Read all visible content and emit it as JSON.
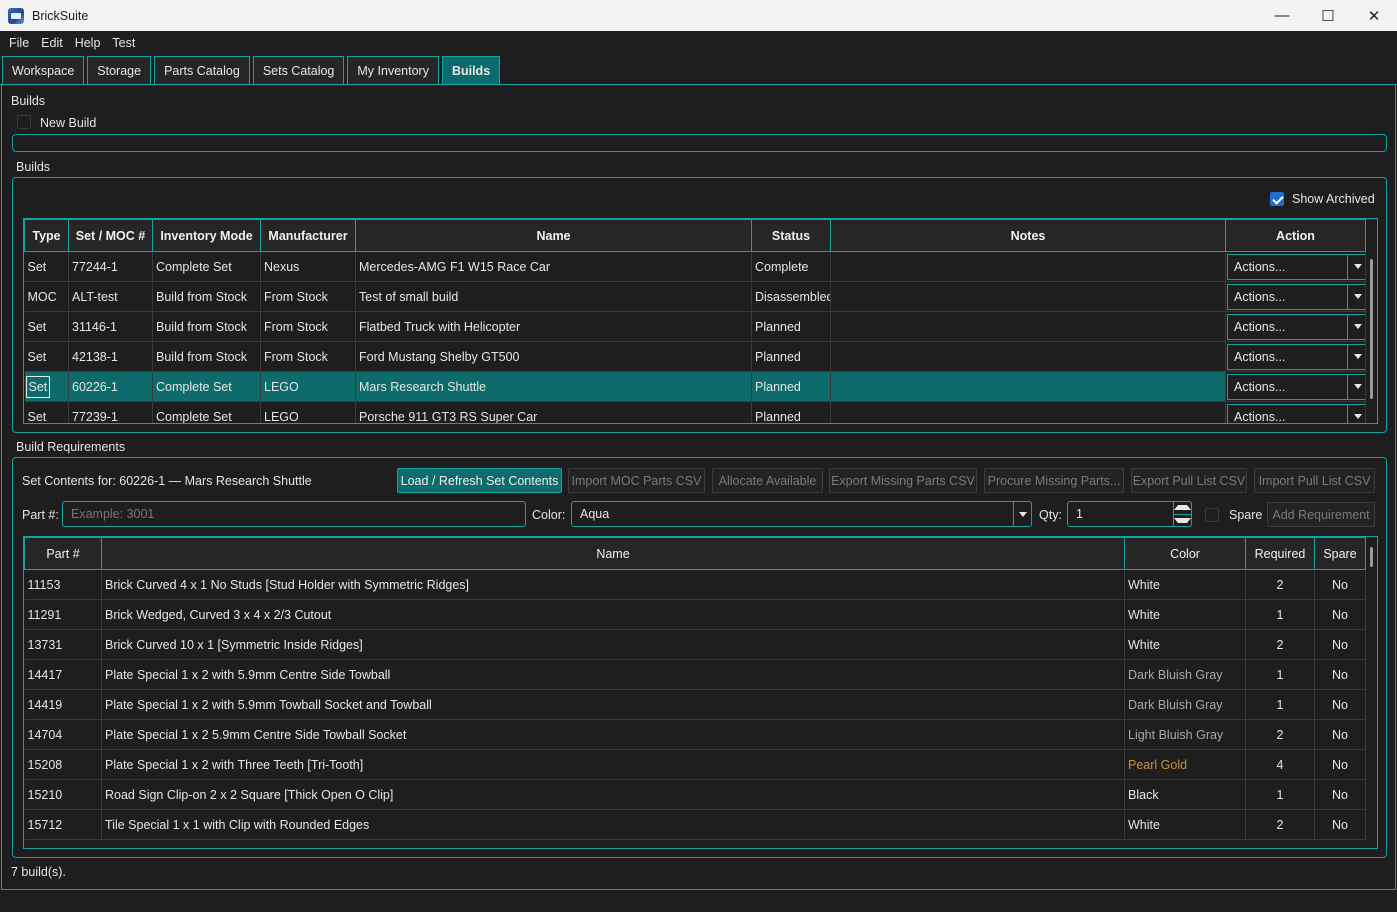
{
  "window": {
    "title": "BrickSuite",
    "minimize": "—",
    "maximize": "☐",
    "close": "✕"
  },
  "menu": [
    "File",
    "Edit",
    "Help",
    "Test"
  ],
  "tabs": [
    {
      "label": "Workspace",
      "active": false
    },
    {
      "label": "Storage",
      "active": false
    },
    {
      "label": "Parts Catalog",
      "active": false
    },
    {
      "label": "Sets Catalog",
      "active": false
    },
    {
      "label": "My Inventory",
      "active": false
    },
    {
      "label": "Builds",
      "active": true
    }
  ],
  "builds_header": {
    "section_label": "Builds",
    "new_build_label": "New Build",
    "group_title": "Builds",
    "show_archived_label": "Show Archived",
    "show_archived_checked": true
  },
  "builds_table": {
    "columns": [
      "Type",
      "Set / MOC #",
      "Inventory Mode",
      "Manufacturer",
      "Name",
      "Status",
      "Notes",
      "Action"
    ],
    "rows": [
      {
        "type": "Set",
        "number": "77244-1",
        "mode": "Complete Set",
        "manufacturer": "Nexus",
        "name": "Mercedes-AMG F1 W15 Race Car",
        "status": "Complete",
        "notes": "",
        "action": "Actions..."
      },
      {
        "type": "MOC",
        "number": "ALT-test",
        "mode": "Build from Stock",
        "manufacturer": "From Stock",
        "name": "Test of small build",
        "status": "Disassembled",
        "notes": "",
        "action": "Actions..."
      },
      {
        "type": "Set",
        "number": "31146-1",
        "mode": "Build from Stock",
        "manufacturer": "From Stock",
        "name": "Flatbed Truck with Helicopter",
        "status": "Planned",
        "notes": "",
        "action": "Actions..."
      },
      {
        "type": "Set",
        "number": "42138-1",
        "mode": "Build from Stock",
        "manufacturer": "From Stock",
        "name": "Ford Mustang Shelby GT500",
        "status": "Planned",
        "notes": "",
        "action": "Actions..."
      },
      {
        "type": "Set",
        "number": "60226-1",
        "mode": "Complete Set",
        "manufacturer": "LEGO",
        "name": "Mars Research Shuttle",
        "status": "Planned",
        "notes": "",
        "action": "Actions...",
        "selected": true
      },
      {
        "type": "Set",
        "number": "77239-1",
        "mode": "Complete Set",
        "manufacturer": "LEGO",
        "name": "Porsche 911 GT3 RS Super Car",
        "status": "Planned",
        "notes": "",
        "action": "Actions..."
      }
    ]
  },
  "requirements": {
    "group_title": "Build Requirements",
    "set_contents_label": "Set Contents for: 60226-1 — Mars Research Shuttle",
    "buttons": {
      "load_refresh": "Load / Refresh Set Contents",
      "import_moc": "Import MOC Parts CSV",
      "allocate": "Allocate Available",
      "export_missing": "Export Missing Parts CSV",
      "procure_missing": "Procure Missing Parts...",
      "export_pull": "Export Pull List CSV",
      "import_pull": "Import Pull List CSV",
      "add_requirement": "Add Requirement"
    },
    "part_label": "Part #:",
    "part_placeholder": "Example: 3001",
    "color_label": "Color:",
    "color_value": "Aqua",
    "qty_label": "Qty:",
    "qty_value": "1",
    "spare_label": "Spare",
    "columns": [
      "Part #",
      "Name",
      "Color",
      "Required",
      "Spare"
    ],
    "rows": [
      {
        "part": "11153",
        "name": "Brick Curved 4 x 1 No Studs [Stud Holder with Symmetric Ridges]",
        "color": "White",
        "color_style": "normal",
        "required": "2",
        "spare": "No"
      },
      {
        "part": "11291",
        "name": "Brick Wedged, Curved 3 x 4 x 2/3 Cutout",
        "color": "White",
        "color_style": "normal",
        "required": "1",
        "spare": "No"
      },
      {
        "part": "13731",
        "name": "Brick Curved 10 x 1 [Symmetric Inside Ridges]",
        "color": "White",
        "color_style": "normal",
        "required": "2",
        "spare": "No"
      },
      {
        "part": "14417",
        "name": "Plate Special 1 x 2 with 5.9mm Centre Side Towball",
        "color": "Dark Bluish Gray",
        "color_style": "dim",
        "required": "1",
        "spare": "No"
      },
      {
        "part": "14419",
        "name": "Plate Special 1 x 2 with 5.9mm Towball Socket and Towball",
        "color": "Dark Bluish Gray",
        "color_style": "dim",
        "required": "1",
        "spare": "No"
      },
      {
        "part": "14704",
        "name": "Plate Special 1 x 2 5.9mm Centre Side Towball Socket",
        "color": "Light Bluish Gray",
        "color_style": "dim",
        "required": "2",
        "spare": "No"
      },
      {
        "part": "15208",
        "name": "Plate Special 1 x 2 with Three Teeth [Tri-Tooth]",
        "color": "Pearl Gold",
        "color_style": "gold",
        "required": "4",
        "spare": "No"
      },
      {
        "part": "15210",
        "name": "Road Sign Clip-on 2 x 2 Square [Thick Open O Clip]",
        "color": "Black",
        "color_style": "normal",
        "required": "1",
        "spare": "No"
      },
      {
        "part": "15712",
        "name": "Tile Special 1 x 1 with Clip with Rounded Edges",
        "color": "White",
        "color_style": "normal",
        "required": "2",
        "spare": "No"
      }
    ]
  },
  "status_text": "7 build(s).",
  "colors": {
    "accent": "#16a3a3",
    "selected": "#0e6b6b",
    "background": "#1e1e1e",
    "gold": "#c8903a",
    "checkbox": "#1f6fd1"
  }
}
